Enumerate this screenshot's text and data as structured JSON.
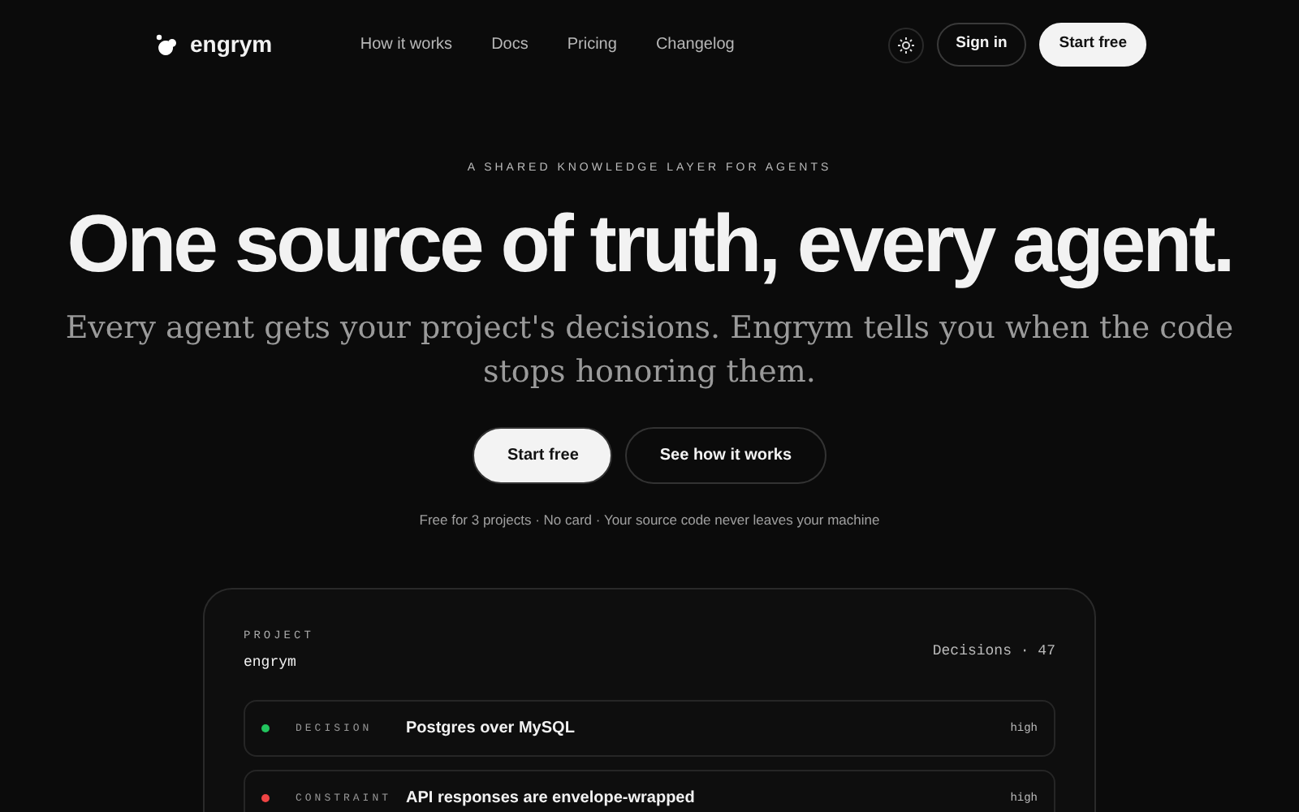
{
  "brand": "engrym",
  "nav": [
    "How it works",
    "Docs",
    "Pricing",
    "Changelog"
  ],
  "header_buttons": [
    {
      "label": "Sign in",
      "kind": "outline"
    },
    {
      "label": "Start free",
      "kind": "solid"
    }
  ],
  "hero": {
    "eyebrow": "A SHARED KNOWLEDGE LAYER FOR AGENTS",
    "title": "One source of truth, every agent.",
    "subtitle": "Every agent gets your project's decisions. Engrym tells you when the code stops honoring them.",
    "buttons": [
      {
        "label": "Start free",
        "kind": "solid"
      },
      {
        "label": "See how it works",
        "kind": "outline"
      }
    ],
    "note": "Free for 3 projects · No card · Your source code never leaves your machine"
  },
  "project": {
    "label": "PROJECT",
    "name": "engrym",
    "count": "Decisions · 47",
    "rows": [
      {
        "type": "DECISION",
        "color": "#22c55e",
        "title": "Postgres over MySQL",
        "confidence": "high"
      },
      {
        "type": "CONSTRAINT",
        "color": "#ef4444",
        "title": "API responses are envelope-wrapped",
        "confidence": "high"
      }
    ]
  }
}
